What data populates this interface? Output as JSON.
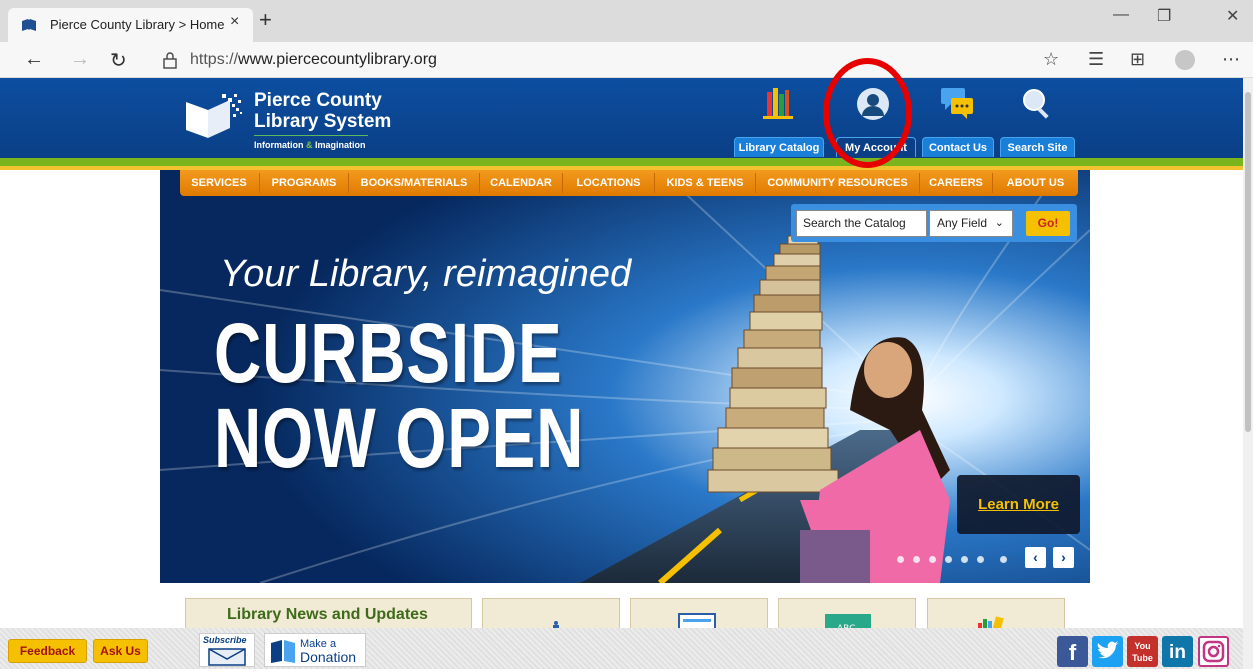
{
  "browser": {
    "tab_title": "Pierce County Library > Home",
    "tab_close": "×",
    "new_tab": "+",
    "url_protocol": "https://",
    "url_host": "www.piercecountylibrary.org",
    "window_controls": [
      "—",
      "❐",
      "✕"
    ],
    "icons": [
      "back-icon",
      "forward-icon",
      "refresh-icon",
      "lock-icon",
      "star-icon",
      "favorites-icon",
      "collections-icon",
      "profile-icon",
      "more-icon"
    ]
  },
  "header": {
    "logo_line1": "Pierce County",
    "logo_line2": "Library System",
    "tagline_a": "Information ",
    "tagline_amp": "&",
    "tagline_b": " Imagination",
    "buttons": [
      "Library Catalog",
      "My Account",
      "Contact Us",
      "Search Site"
    ]
  },
  "nav": {
    "items": [
      "SERVICES",
      "PROGRAMS",
      "BOOKS/MATERIALS",
      "CALENDAR",
      "LOCATIONS",
      "KIDS & TEENS",
      "COMMUNITY RESOURCES",
      "CAREERS",
      "ABOUT US"
    ]
  },
  "search": {
    "input_value": "Search the Catalog",
    "field_select": "Any Field",
    "go_label": "Go!"
  },
  "hero": {
    "subtitle": "Your Library, reimagined",
    "headline1": "CURBSIDE",
    "headline2": "NOW OPEN",
    "cta": "Learn More",
    "slide_count": 7,
    "prev": "‹",
    "next": "›"
  },
  "panels": {
    "news_title": "Library News and Updates"
  },
  "bottom": {
    "feedback": "Feedback",
    "ask_us": "Ask Us",
    "subscribe": "Subscribe",
    "donation_l1": "Make a",
    "donation_l2": "Donation",
    "social": [
      "f",
      "t",
      "You Tube",
      "in",
      "ig"
    ]
  },
  "colors": {
    "header_blue": "#0d4ea0",
    "nav_orange": "#f39a1e",
    "accent_yellow": "#f5c000",
    "green": "#7ab51d",
    "annotation_red": "#e60000"
  }
}
